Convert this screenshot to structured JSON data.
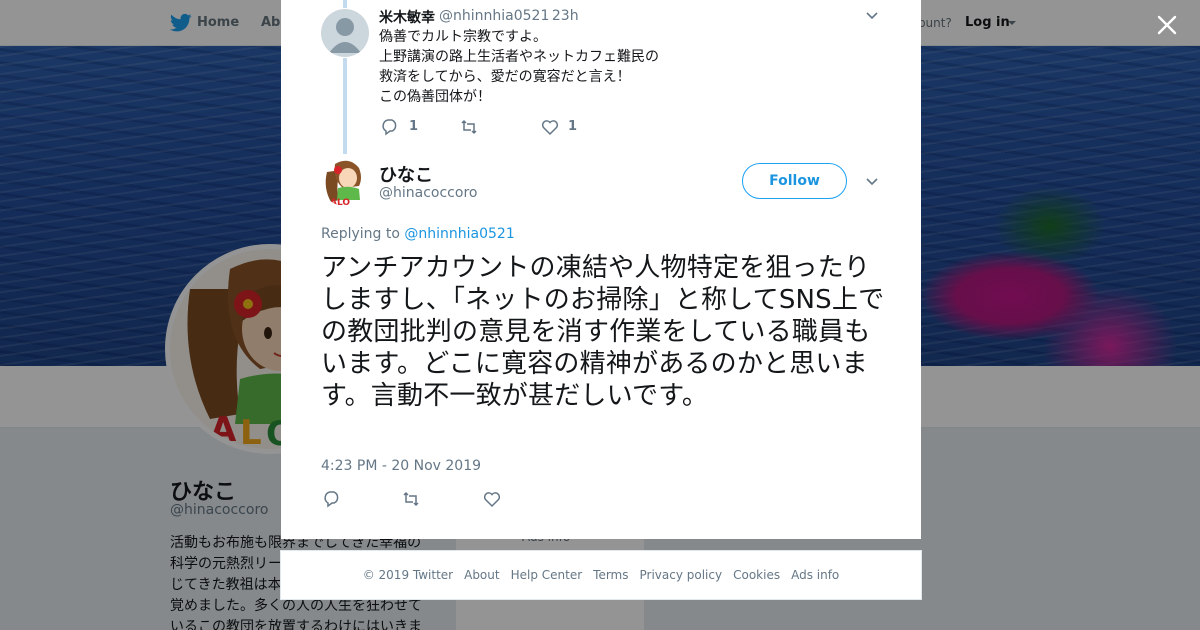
{
  "topbar": {
    "home_label": "Home",
    "about_label": "Abo",
    "account_text": "ccount?",
    "login_label": "Log in"
  },
  "profile": {
    "name": "ひなこ",
    "handle": "@hinacoccoro",
    "bio_lines": [
      "活動もお布施も限界までしてきた幸福の",
      "科学の元熱烈リー",
      "じてきた教祖は本",
      "覚めました。多くの人の人生を狂わせて",
      "いるこの教団を放置するわけにはいきま"
    ],
    "card_text": "Ads info"
  },
  "reply_tweet": {
    "name": "米木敏幸",
    "handle": "@nhinnhia0521",
    "time": "· 23h",
    "lines": [
      "偽善でカルト宗教ですよ。",
      "上野講演の路上生活者やネットカフェ難民の",
      "救済をしてから、愛だの寛容だと言え！",
      "この偽善団体が！"
    ],
    "reply_count": "1",
    "retweet_count": "",
    "like_count": "1"
  },
  "main_tweet": {
    "name": "ひなこ",
    "handle": "@hinacoccoro",
    "follow_label": "Follow",
    "replying_prefix": "Replying to ",
    "replying_handle": "@nhinnhia0521",
    "text": "アンチアカウントの凍結や人物特定を狙ったりしますし、「ネットのお掃除」と称してSNS上での教団批判の意見を消す作業をしている職員もいます。どこに寛容の精神があるのかと思います。言動不一致が甚だしいです。",
    "timestamp": "4:23 PM - 20 Nov 2019"
  },
  "footer": {
    "links": [
      "© 2019 Twitter",
      "About",
      "Help Center",
      "Terms",
      "Privacy policy",
      "Cookies",
      "Ads info"
    ]
  },
  "colors": {
    "accent": "#1da1f2",
    "link": "#1b95e0",
    "secondary_text": "#657786",
    "thread_line": "#c4dbef"
  },
  "icons": {
    "close": "close-icon",
    "logo": "twitter-bird-icon",
    "reply": "reply-icon",
    "retweet": "retweet-icon",
    "like": "heart-icon",
    "menu": "chevron-down-icon"
  }
}
